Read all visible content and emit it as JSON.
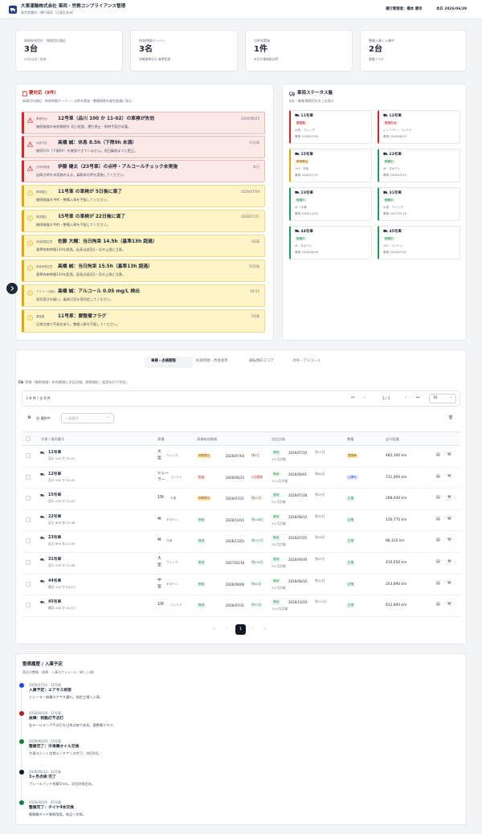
{
  "header": {
    "title": "大東運輸株式会社 車両・労務コンプライアンス管理",
    "subtitle": "東京営業所・運行車両（江東区若洲）",
    "user": "運行管理者：橋本 健司",
    "date": "本日 2026/06/29"
  },
  "summary": [
    {
      "label": "車検有効切れ・期限切れ間近",
      "value": "3台",
      "sub": "30日以内 / 失効"
    },
    {
      "label": "拘束時間オーバー",
      "value": "3名",
      "sub": "改善基準告示 基準超過"
    },
    {
      "label": "点呼未実施",
      "value": "1件",
      "sub": "本日の乗務前点呼"
    },
    {
      "label": "整備入庫 / 入庫中",
      "value": "2台",
      "sub": "整備フラグ"
    }
  ],
  "alerts": {
    "title": "要対応（9件）",
    "subtitle": "車検切れ間近・拘束時間オーバー・点呼未実施・整備期限を優先度順に表示",
    "items": [
      {
        "tag": "車検失効",
        "title": "12号車（品川 100 か 11-02）の車検が失効",
        "desc": "継続検査の有効期限を 4日 超過。運行停止・即時手配が必要。",
        "date": "2026/06/25"
      },
      {
        "tag": "休息不足",
        "title": "髙橋 誠：休息 8.5h（下限9h 未満）",
        "desc": "継続11h（下限9h）を確保できていません。次回乗務までに是正。",
        "date": "15号車"
      },
      {
        "tag": "点呼未実施",
        "title": "伊藤 健太（23号車）の点呼・アルコールチェック未実施",
        "desc": "出庫点呼を未実施のまま。乗務前点呼を実施してください。",
        "date": "本日"
      },
      {
        "tag": "車検間近",
        "title": "11号車 の車検が 5日後に満了",
        "desc": "継続検査の予約・整備入庫を手配してください。",
        "date": "2026/07/04"
      },
      {
        "tag": "車検間近",
        "title": "15号車 の車検が 22日後に満了",
        "desc": "継続検査の予約・整備入庫を手配してください。",
        "date": "2026/07/21"
      },
      {
        "tag": "拘束時間注意",
        "title": "佐藤 大輔：当日拘束 14.5h（基準13h 超過）",
        "desc": "基準拘束時間13hを超過。延長は週2回・月の上限に注意。",
        "date": "3号車"
      },
      {
        "tag": "拘束時間注意",
        "title": "髙橋 誠：当日拘束 15.5h（基準13h 超過）",
        "desc": "基準拘束時間13hを超過。延長は週2回・月の上限に注意。",
        "date": "15号車"
      },
      {
        "tag": "アルコール検出",
        "title": "髙橋 誠：アルコール 0.05 mg/L 検出",
        "desc": "酒気帯びの疑い。乗務可否を再判定してください。",
        "date": "04:55"
      },
      {
        "tag": "要整備",
        "title": "11号車：要整備フラグ",
        "desc": "日常点検で不具合あり。整備入庫を手配してください。",
        "date": "3号車"
      }
    ]
  },
  "status": {
    "title": "車両ステータス盤",
    "subtitle": "8台・故障/期限切れを上位表示",
    "cards": [
      {
        "name": "11号車",
        "badge": "要整備",
        "l1": "大型・ウイング",
        "l2": "車検 2026/07/04"
      },
      {
        "name": "12号車",
        "badge": "車検失効",
        "l1": "トレーラー・コンテナ",
        "l2": "車検 2026/06/25"
      },
      {
        "name": "15号車",
        "badge": "車検間近",
        "l1": "10t・冷凍",
        "l2": "車検 2026/07/21"
      },
      {
        "name": "22号車",
        "badge": "稼働中",
        "l1": "4t・平ボディ",
        "l2": "車検 2026/10/15"
      },
      {
        "name": "23号車",
        "badge": "稼働中",
        "l1": "4t・冷凍",
        "l2": "車検 2026/12/03"
      },
      {
        "name": "31号車",
        "badge": "稼働中",
        "l1": "大型・ウイング",
        "l2": "車検 2027/02/18"
      },
      {
        "name": "44号車",
        "badge": "稼働中",
        "l1": "4t・平ボディ",
        "l2": "車検 2026/08/06"
      },
      {
        "name": "45号車",
        "badge": "稼働中",
        "l1": "10t・コンテナ",
        "l2": "車検 2026/07/31"
      }
    ]
  },
  "tabs": [
    "車検・点検期限",
    "拘束時間・改善基準",
    "運転傾向スコア",
    "点呼・アルコール"
  ],
  "table": {
    "note": "車検（継続検査）有効期限と次回点検。期限間近・超過を行で判定。",
    "count": "1–8 件 / 全 8 件",
    "page": "1 / 1",
    "per_page": "10",
    "selected": "台 選択中",
    "bulk": "一括操作",
    "headers": [
      "号車 / 車両番号",
      "車種",
      "車検有効期限",
      "次回点検",
      "整備",
      "走行距離"
    ],
    "rows": [
      {
        "no": "11号車",
        "plate": "品川 100 か 11-01",
        "type1": "大",
        "type2": "型",
        "body": "ウイング",
        "exp_badge": "期限間近",
        "exp_date": "2026/07/04",
        "exp_note": "残5日",
        "insp_badge": "有効",
        "insp_date": "2026/07/10",
        "insp_note": "残11日",
        "insp_sub": "3ヶ月点検",
        "maint": "要整備",
        "km": "482,300 km"
      },
      {
        "no": "12号車",
        "plate": "品川 100 か 11-02",
        "type1": "トレー",
        "type2": "ラー",
        "body": "コンテナ",
        "exp_badge": "失効",
        "exp_date": "2026/06/25",
        "exp_note": "4日超過",
        "insp_badge": "有効",
        "insp_date": "2026/09/01",
        "insp_note": "残64日",
        "insp_sub": "12ヶ月点検",
        "maint": "入庫中",
        "km": "731,900 km"
      },
      {
        "no": "15号車",
        "plate": "品川 100 か 11-03",
        "type1": "10t",
        "type2": "",
        "body": "冷凍",
        "exp_badge": "期限間近",
        "exp_date": "2026/07/21",
        "exp_note": "残22日",
        "insp_badge": "有効",
        "insp_date": "2026/07/28",
        "insp_note": "残29日",
        "insp_sub": "3ヶ月点検",
        "maint": "正常",
        "km": "298,440 km"
      },
      {
        "no": "22号車",
        "plate": "足立 800 あ 22-06",
        "type1": "4t",
        "type2": "",
        "body": "平ボディ",
        "exp_badge": "有効",
        "exp_date": "2026/10/15",
        "exp_note": "残108日",
        "insp_badge": "有効",
        "insp_date": "2026/08/13",
        "insp_note": "残45日",
        "insp_sub": "3ヶ月点検",
        "maint": "正常",
        "km": "156,770 km"
      },
      {
        "no": "23号車",
        "plate": "足立 800 あ 22-05",
        "type1": "4t",
        "type2": "",
        "body": "冷凍",
        "exp_badge": "有効",
        "exp_date": "2026/12/03",
        "exp_note": "残157日",
        "insp_badge": "有効",
        "insp_date": "2026/07/25",
        "insp_note": "残26日",
        "insp_sub": "3ヶ月点検",
        "maint": "正常",
        "km": "88,120 km"
      },
      {
        "no": "31号車",
        "plate": "品川 100 か 11-06",
        "type1": "大",
        "type2": "型",
        "body": "ウイング",
        "exp_badge": "有効",
        "exp_date": "2027/02/18",
        "exp_note": "残234日",
        "insp_badge": "有効",
        "insp_date": "2026/09/30",
        "insp_note": "残93日",
        "insp_sub": "3ヶ月点検",
        "maint": "正常",
        "km": "410,050 km"
      },
      {
        "no": "44号車",
        "plate": "横浜 100 か 44-12",
        "type1": "中",
        "type2": "型",
        "body": "平ボディ",
        "exp_badge": "有効",
        "exp_date": "2026/08/06",
        "exp_note": "残40日",
        "insp_badge": "有効",
        "insp_date": "2026/08/10",
        "insp_note": "残42日",
        "insp_sub": "3ヶ月点検",
        "maint": "正常",
        "km": "203,890 km"
      },
      {
        "no": "45号車",
        "plate": "横浜 100 か 44-13",
        "type1": "10t",
        "type2": "",
        "body": "コンテナ",
        "exp_badge": "有効",
        "exp_date": "2026/07/31",
        "exp_note": "残32日",
        "insp_badge": "有効",
        "insp_date": "2026/10/20",
        "insp_note": "残113日",
        "insp_sub": "12ヶ月点検",
        "maint": "正常",
        "km": "612,800 km"
      }
    ]
  },
  "pager": {
    "current": "1"
  },
  "history": {
    "title": "整備履歴 / 入庫予定",
    "subtitle": "直近の整備・故障・入庫スケジュール（新しい順）",
    "items": [
      {
        "meta": "2026/07/02 · 12号車",
        "title": "入庫予定：エアサス修理",
        "desc": "トレーラー後輪エアサス漏れ。指定工場へ入庫。",
        "color": "#1d4ed8"
      },
      {
        "meta": "2026/06/28 · 11号車",
        "title": "故障：制動灯不点灯",
        "desc": "右テールランプ不点灯を日常点検で発見。要整備フラグ。",
        "color": "#b91c1c"
      },
      {
        "meta": "2026/06/20 · 15号車",
        "title": "整備完了：冷凍機オイル交換",
        "desc": "冷凍ユニット定期メンテナンス完了。次回9月。",
        "color": "#15803d"
      },
      {
        "meta": "2026/06/12 · 22号車",
        "title": "3ヶ月点検 完了",
        "desc": "ブレーキパッド残量5mm。次回交換目安。",
        "color": "#111827"
      },
      {
        "meta": "2026/06/05 · 45号車",
        "title": "整備完了：タイヤ4本交換",
        "desc": "駆動輪タイヤ摩耗限度。新品へ交換。",
        "color": "#15803d"
      }
    ]
  },
  "colors": {
    "red": "#dc2626",
    "amber": "#e0a800",
    "green": "#16a34a",
    "navy": "#1e3a8a"
  }
}
